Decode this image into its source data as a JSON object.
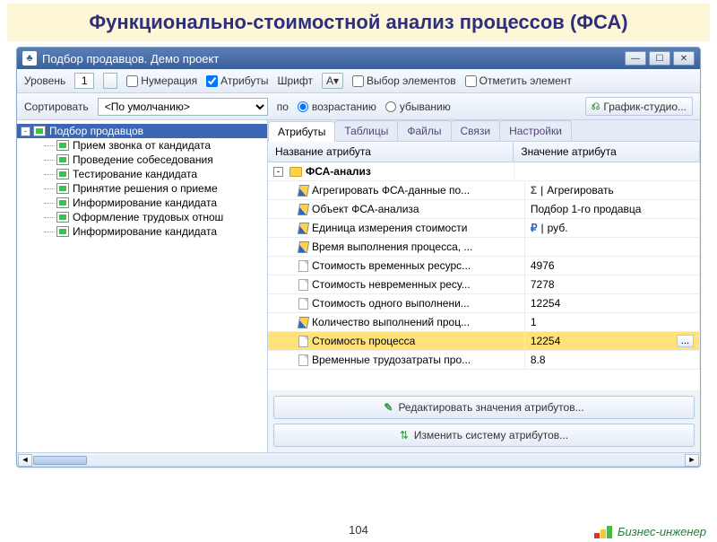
{
  "slide": {
    "title": "Функционально-стоимостной анализ процессов (ФСА)",
    "page": "104",
    "brand": "Бизнес-инженер"
  },
  "window": {
    "title": "Подбор продавцов. Демо проект"
  },
  "toolbar1": {
    "level_label": "Уровень",
    "level_value": "1",
    "numbering": "Нумерация",
    "attributes": "Атрибуты",
    "font": "Шрифт",
    "select_elements": "Выбор элементов",
    "mark_element": "Отметить элемент"
  },
  "toolbar2": {
    "sort": "Сортировать",
    "default_sort": "<По умолчанию>",
    "by": "по",
    "asc": "возрастанию",
    "desc": "убыванию",
    "graph": "График-студио..."
  },
  "tree": {
    "root": "Подбор продавцов",
    "items": [
      "Прием звонка от кандидата",
      "Проведение собеседования",
      "Тестирование кандидата",
      "Принятие решения о приеме",
      "Информирование кандидата",
      "Оформление трудовых отнош",
      "Информирование кандидата"
    ]
  },
  "tabs": {
    "t0": "Атрибуты",
    "t1": "Таблицы",
    "t2": "Файлы",
    "t3": "Связи",
    "t4": "Настройки"
  },
  "attr_head": {
    "name": "Название атрибута",
    "value": "Значение атрибута"
  },
  "attrs": {
    "group": "ФСА-анализ",
    "rows": [
      {
        "n": "Агрегировать ФСА-данные по...",
        "v": "Агрегировать",
        "icon": "pencil",
        "vicon": "sigma"
      },
      {
        "n": "Объект ФСА-анализа",
        "v": "Подбор 1-го продавца",
        "icon": "pencil"
      },
      {
        "n": "Единица измерения стоимости",
        "v": "руб.",
        "icon": "pencil",
        "vicon": "ruble"
      },
      {
        "n": "Время выполнения процесса, ...",
        "v": "",
        "icon": "pencil"
      },
      {
        "n": "Стоимость временных ресурс...",
        "v": "4976",
        "icon": "doc"
      },
      {
        "n": "Стоимость невременных ресу...",
        "v": "7278",
        "icon": "doc"
      },
      {
        "n": "Стоимость одного выполнени...",
        "v": "12254",
        "icon": "doc"
      },
      {
        "n": "Количество выполнений проц...",
        "v": "1",
        "icon": "pencil"
      },
      {
        "n": "Стоимость процесса",
        "v": "12254",
        "icon": "doc",
        "sel": true,
        "more": true
      },
      {
        "n": "Временные трудозатраты про...",
        "v": "8.8",
        "icon": "doc"
      }
    ]
  },
  "buttons": {
    "edit": "Редактировать значения атрибутов...",
    "change": "Изменить систему атрибутов..."
  }
}
